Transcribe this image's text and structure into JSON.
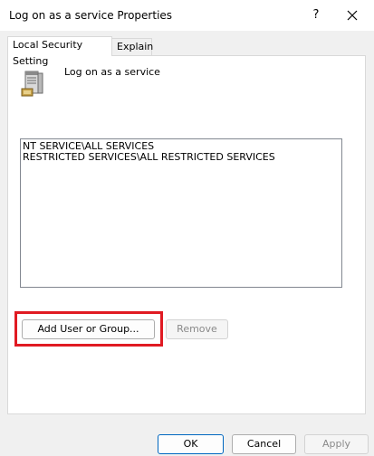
{
  "window": {
    "title": "Log on as a service Properties",
    "help_glyph": "?",
    "close_icon": "close-icon"
  },
  "tabs": [
    {
      "label": "Local Security Setting",
      "selected": true
    },
    {
      "label": "Explain",
      "selected": false
    }
  ],
  "policy": {
    "icon": "server-icon",
    "title": "Log on as a service"
  },
  "accounts_list": [
    "NT SERVICE\\ALL SERVICES",
    "RESTRICTED SERVICES\\ALL RESTRICTED SERVICES"
  ],
  "actions": {
    "add_label": "Add User or Group...",
    "remove_label": "Remove",
    "remove_enabled": false
  },
  "footer": {
    "ok_label": "OK",
    "cancel_label": "Cancel",
    "apply_label": "Apply",
    "apply_enabled": false
  },
  "colors": {
    "highlight": "#e01a22",
    "ok_border": "#0067c0"
  }
}
